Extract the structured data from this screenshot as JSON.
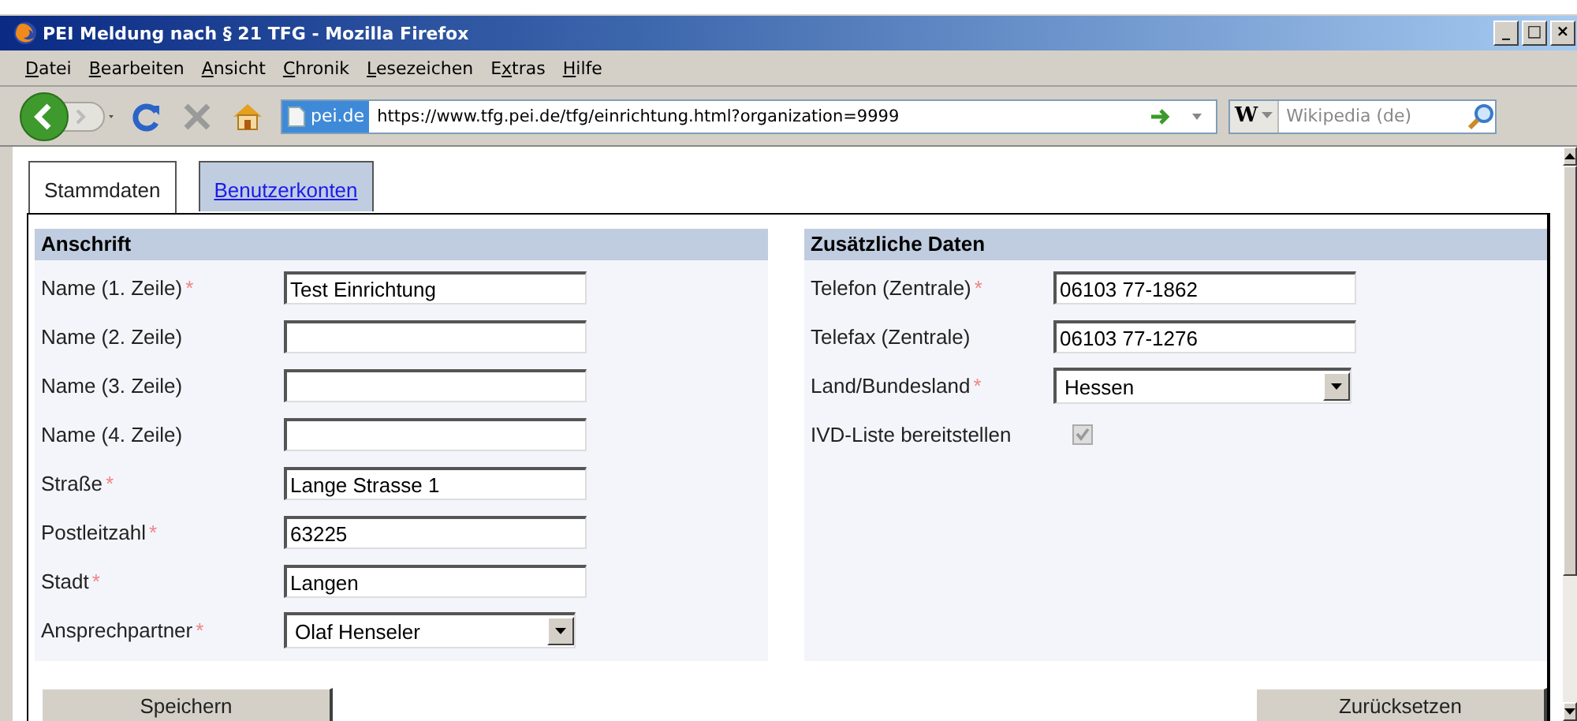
{
  "window": {
    "title": "PEI Meldung nach § 21 TFG - Mozilla Firefox",
    "controls": [
      "_",
      "□",
      "×"
    ]
  },
  "menu": [
    {
      "key": "D",
      "rest": "atei"
    },
    {
      "key": "B",
      "rest": "earbeiten"
    },
    {
      "key": "A",
      "rest": "nsicht"
    },
    {
      "key": "C",
      "rest": "hronik"
    },
    {
      "key": "L",
      "rest": "esezeichen"
    },
    {
      "before": "E",
      "key": "x",
      "rest": "tras"
    },
    {
      "key": "H",
      "rest": "ilfe"
    }
  ],
  "address_bar": {
    "site": "pei.de",
    "url": "https://www.tfg.pei.de/tfg/einrichtung.html?organization=9999"
  },
  "search": {
    "placeholder": "Wikipedia (de)",
    "engine": "W"
  },
  "tabs": [
    {
      "label": "Stammdaten",
      "selected": true
    },
    {
      "label": "Benutzerkonten",
      "selected": false
    }
  ],
  "sections": [
    {
      "title": "Anschrift",
      "fields": [
        {
          "kind": "text",
          "label": "Name (1. Zeile)",
          "required_mark": "*",
          "value": "Test Einrichtung"
        },
        {
          "kind": "text",
          "label": "Name (2. Zeile)"
        },
        {
          "kind": "text",
          "label": "Name (3. Zeile)"
        },
        {
          "kind": "text",
          "label": "Name (4. Zeile)"
        },
        {
          "kind": "text",
          "label": "Straße",
          "required_mark": "*",
          "value": "Lange Strasse 1"
        },
        {
          "kind": "text",
          "label": "Postleitzahl",
          "required_mark": "*",
          "value": "63225"
        },
        {
          "kind": "text",
          "label": "Stadt",
          "required_mark": "*",
          "value": "Langen"
        },
        {
          "kind": "select",
          "label": "Ansprechpartner",
          "required_mark": "*",
          "value": "Olaf Henseler"
        }
      ]
    },
    {
      "title": "Zusätzliche Daten",
      "fields": [
        {
          "kind": "text",
          "label": "Telefon (Zentrale)",
          "required_mark": "*",
          "value": "06103 77-1862"
        },
        {
          "kind": "text",
          "label": "Telefax (Zentrale)",
          "value": "06103 77-1276"
        },
        {
          "kind": "select",
          "label": "Land/Bundesland",
          "required_mark": "*",
          "value": "Hessen"
        },
        {
          "kind": "checkbox",
          "label": "IVD-Liste bereitstellen",
          "checked": true,
          "disabled": true
        }
      ]
    }
  ],
  "buttons": [
    "Speichern",
    "Zurücksetzen"
  ]
}
